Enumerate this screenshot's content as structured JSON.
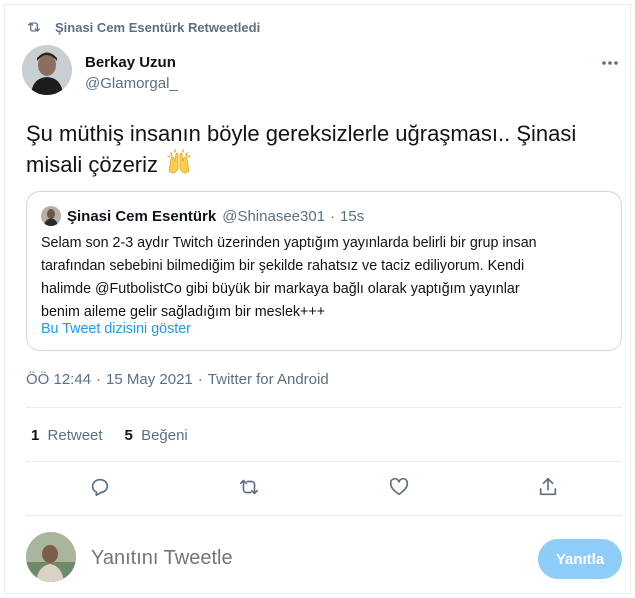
{
  "retweet_context": {
    "text": "Şinasi Cem Esentürk Retweetledi",
    "icon": "retweet-icon"
  },
  "author": {
    "name": "Berkay Uzun",
    "handle": "@Glamorgal_"
  },
  "tweet": {
    "line1": "Şu müthiş insanın böyle gereksizlerle uğraşması..  Şinasi",
    "line2": "misali çözeriz",
    "emoji": "raising-hands-emoji"
  },
  "quote": {
    "name": "Şinasi Cem Esentürk",
    "handle": "@Shinasee301",
    "dot": "·",
    "time": "15s",
    "lines": [
      "Selam son 2-3 aydır Twitch üzerinden yaptığım yayınlarda belirli bir grup insan",
      "tarafından sebebini bilmediğim bir şekilde rahatsız ve taciz ediliyorum. Kendi",
      "halimde @FutbolistCo gibi büyük bir markaya bağlı olarak yaptığım yayınlar",
      "benim aileme gelir sağladığım bir meslek+++"
    ],
    "link": "Bu Tweet dizisini göster"
  },
  "meta": {
    "time": "ÖÖ 12:44",
    "sep": "·",
    "date": "15 May 2021",
    "source": "Twitter for Android"
  },
  "stats": {
    "retweets": {
      "count": "1",
      "label": "Retweet"
    },
    "likes": {
      "count": "5",
      "label": "Beğeni"
    }
  },
  "reply": {
    "placeholder": "Yanıtını Tweetle",
    "button": "Yanıtla"
  },
  "colors": {
    "accent": "#1d9bf0",
    "muted": "#5b7083",
    "button_disabled": "#8ecdf7",
    "border": "#cfd9de"
  }
}
